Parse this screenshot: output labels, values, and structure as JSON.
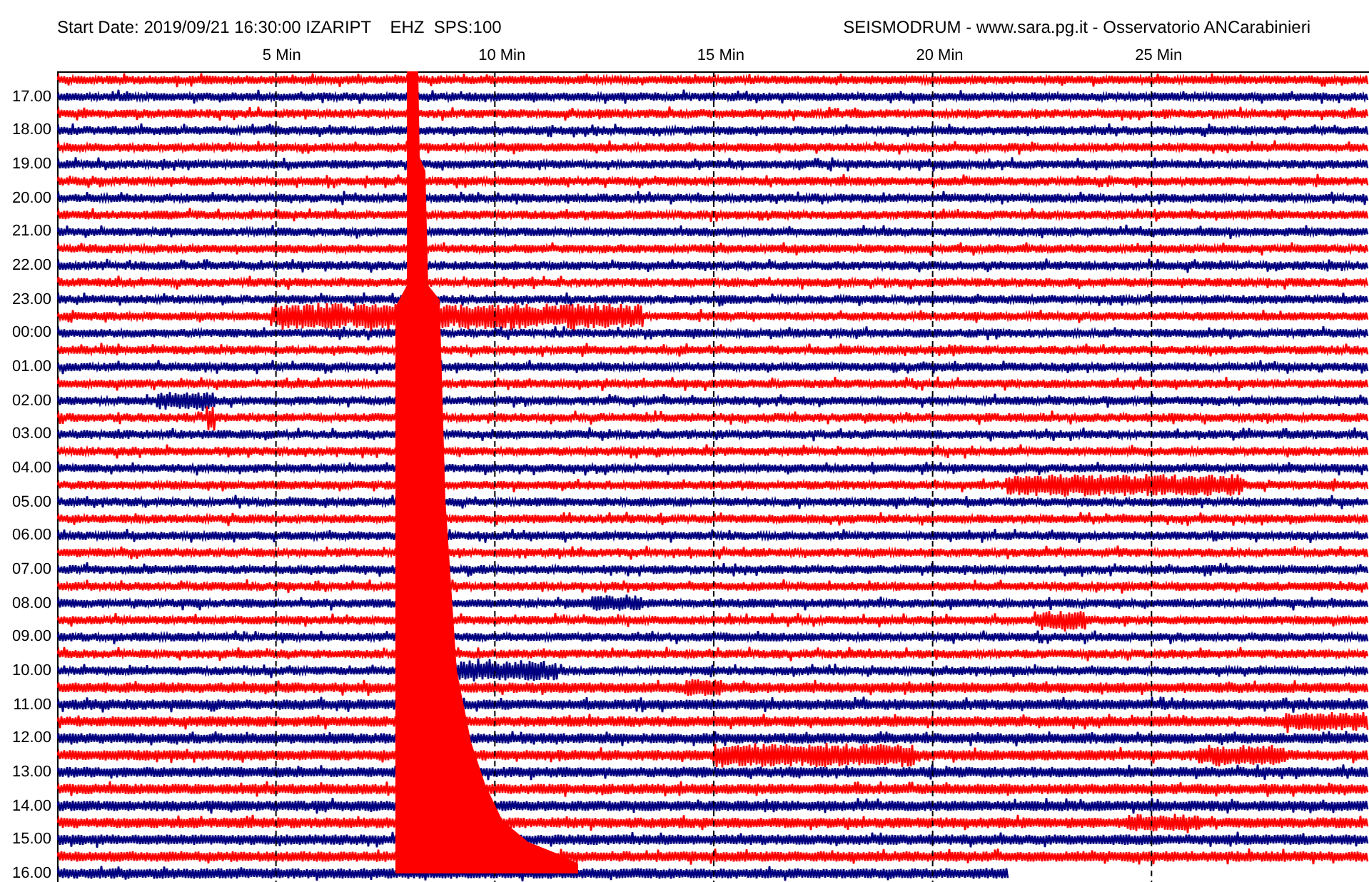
{
  "header": {
    "title": "Start Date: 2019/09/21 16:30:00 IZARIPT    EHZ  SPS:100",
    "source": "SEISMODRUM - www.sara.pg.it - Osservatorio ANCarabinieri"
  },
  "x_ticks": [
    "5 Min",
    "10 Min",
    "15 Min",
    "20 Min",
    "25 Min"
  ],
  "hour_labels": [
    "17.00",
    "18.00",
    "19.00",
    "20.00",
    "21.00",
    "22.00",
    "23.00",
    "00:00",
    "01.00",
    "02.00",
    "03.00",
    "04.00",
    "05.00",
    "06.00",
    "07.00",
    "08.00",
    "09.00",
    "10.00",
    "11.00",
    "12.00",
    "13.00",
    "14.00",
    "15.00",
    "16.00"
  ]
}
